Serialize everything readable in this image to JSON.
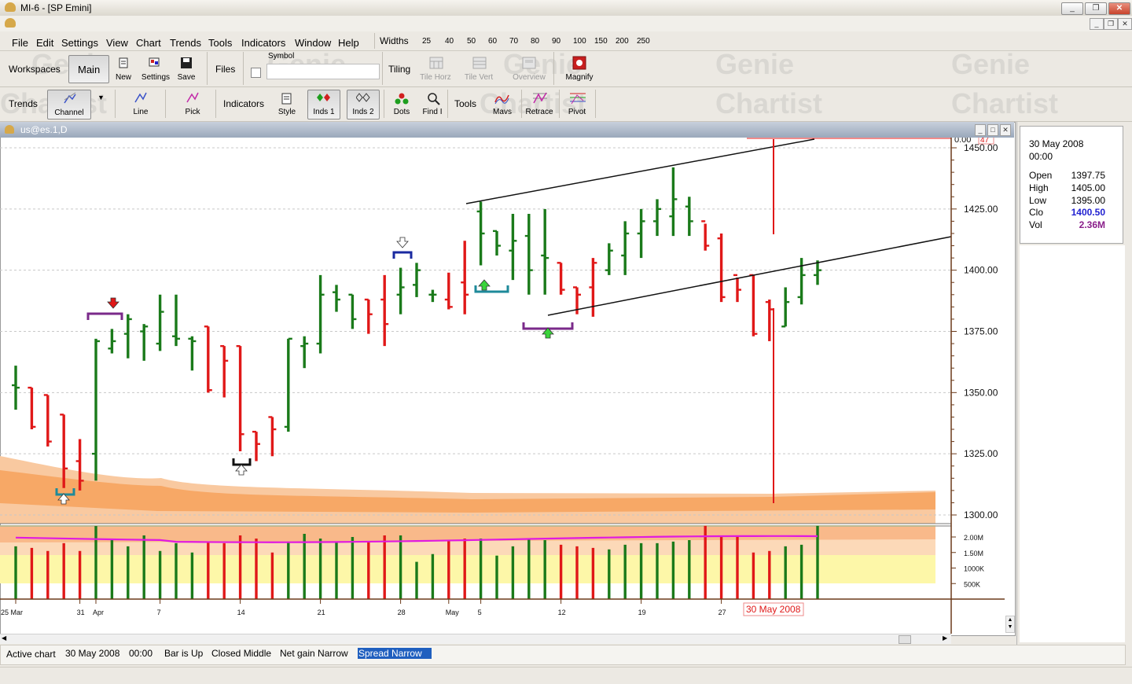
{
  "window": {
    "title": "MI-6 - [SP Emini]"
  },
  "menu": [
    "File",
    "Edit",
    "Settings",
    "View",
    "Chart",
    "Trends",
    "Tools",
    "Indicators",
    "Window",
    "Help"
  ],
  "widths": {
    "label": "Widths",
    "values": [
      "25",
      "40",
      "50",
      "60",
      "70",
      "80",
      "90",
      "100",
      "150",
      "200",
      "250"
    ]
  },
  "toolbar1": {
    "workspaces_label": "Workspaces",
    "main_button": "Main",
    "new_label": "New",
    "settings_label": "Settings",
    "save_label": "Save",
    "files_label": "Files",
    "symbol_label": "Symbol",
    "symbol_value": "",
    "tiling_label": "Tiling",
    "tile_horz": "Tile Horz",
    "tile_vert": "Tile Vert",
    "overview": "Overview",
    "magnify": "Magnify"
  },
  "toolbar2": {
    "trends_label": "Trends",
    "channel": "Channel",
    "line": "Line",
    "pick": "Pick",
    "indicators_label": "Indicators",
    "style": "Style",
    "inds1": "Inds 1",
    "inds2": "Inds 2",
    "dots": "Dots",
    "find": "Find I",
    "tools_label": "Tools",
    "mavs": "Mavs",
    "retrace": "Retrace",
    "pivot": "Pivot"
  },
  "chart_window": {
    "title": "us@es.1,D",
    "top_scale_value": "0.00",
    "top_scale_badge": "47"
  },
  "info_panel": {
    "date": "30 May 2008",
    "time": "00:00",
    "rows": [
      {
        "label": "Open",
        "value": "1397.75",
        "color": "#000000"
      },
      {
        "label": "High",
        "value": "1405.00",
        "color": "#000000"
      },
      {
        "label": "Low",
        "value": "1395.00",
        "color": "#000000"
      },
      {
        "label": "Clo",
        "value": "1400.50",
        "color": "#1f1fd0"
      },
      {
        "label": "Vol",
        "value": "2.36M",
        "color": "#8a1f8a"
      }
    ]
  },
  "chart_data": {
    "type": "bar",
    "instrument": "us@es.1,D",
    "price_axis": {
      "ticks": [
        "1450.00",
        "1425.00",
        "1400.00",
        "1375.00",
        "1350.00",
        "1325.00",
        "1300.00"
      ],
      "ylim": [
        1300,
        1450
      ]
    },
    "volume_axis": {
      "ticks": [
        "2.00M",
        "1.50M",
        "1000K",
        "500K"
      ]
    },
    "x_labels": [
      {
        "label": "25 Mar",
        "bar": 0
      },
      {
        "label": "31",
        "bar": 4
      },
      {
        "label": "Apr",
        "bar": 5
      },
      {
        "label": "7",
        "bar": 9
      },
      {
        "label": "14",
        "bar": 14
      },
      {
        "label": "21",
        "bar": 19
      },
      {
        "label": "28",
        "bar": 24
      },
      {
        "label": "May",
        "bar": 27
      },
      {
        "label": "5",
        "bar": 29
      },
      {
        "label": "12",
        "bar": 34
      },
      {
        "label": "19",
        "bar": 39
      },
      {
        "label": "27",
        "bar": 44
      }
    ],
    "cursor_date_label": "30 May 2008",
    "bars": [
      {
        "o": 1353,
        "h": 1361,
        "l": 1343,
        "c": 1352,
        "up": true,
        "v": 1.7
      },
      {
        "o": 1352,
        "h": 1352,
        "l": 1335,
        "c": 1336,
        "up": false,
        "v": 1.65
      },
      {
        "o": 1349,
        "h": 1349,
        "l": 1328,
        "c": 1330,
        "up": false,
        "v": 1.55
      },
      {
        "o": 1341,
        "h": 1341,
        "l": 1311,
        "c": 1319,
        "up": false,
        "v": 1.8
      },
      {
        "o": 1322,
        "h": 1331,
        "l": 1310,
        "c": 1314,
        "up": false,
        "v": 1.55
      },
      {
        "o": 1325,
        "h": 1372,
        "l": 1314,
        "c": 1371,
        "up": true,
        "v": 2.35
      },
      {
        "o": 1368,
        "h": 1376,
        "l": 1366,
        "c": 1371,
        "up": true,
        "v": 1.9
      },
      {
        "o": 1374,
        "h": 1382,
        "l": 1364,
        "c": 1380,
        "up": true,
        "v": 1.7
      },
      {
        "o": 1375,
        "h": 1378,
        "l": 1363,
        "c": 1377,
        "up": true,
        "v": 2.05
      },
      {
        "o": 1370,
        "h": 1390,
        "l": 1367,
        "c": 1383,
        "up": true,
        "v": 1.55
      },
      {
        "o": 1373,
        "h": 1390,
        "l": 1369,
        "c": 1372,
        "up": true,
        "v": 1.8
      },
      {
        "o": 1372,
        "h": 1373,
        "l": 1359,
        "c": 1371,
        "up": true,
        "v": 1.5
      },
      {
        "o": 1377,
        "h": 1377,
        "l": 1350,
        "c": 1351,
        "up": false,
        "v": 1.85
      },
      {
        "o": 1369,
        "h": 1369,
        "l": 1348,
        "c": 1363,
        "up": false,
        "v": 1.8
      },
      {
        "o": 1369,
        "h": 1369,
        "l": 1326,
        "c": 1333,
        "up": false,
        "v": 2.05
      },
      {
        "o": 1334,
        "h": 1334,
        "l": 1322,
        "c": 1329,
        "up": false,
        "v": 1.95
      },
      {
        "o": 1340,
        "h": 1340,
        "l": 1324,
        "c": 1335,
        "up": false,
        "v": 1.5
      },
      {
        "o": 1336,
        "h": 1372,
        "l": 1334,
        "c": 1372,
        "up": true,
        "v": 1.85
      },
      {
        "o": 1369,
        "h": 1373,
        "l": 1360,
        "c": 1370,
        "up": true,
        "v": 2.1
      },
      {
        "o": 1370,
        "h": 1398,
        "l": 1366,
        "c": 1390,
        "up": true,
        "v": 1.95
      },
      {
        "o": 1391,
        "h": 1394,
        "l": 1383,
        "c": 1388,
        "up": true,
        "v": 1.85
      },
      {
        "o": 1390,
        "h": 1390,
        "l": 1376,
        "c": 1380,
        "up": true,
        "v": 2.0
      },
      {
        "o": 1388,
        "h": 1388,
        "l": 1374,
        "c": 1382,
        "up": false,
        "v": 1.85
      },
      {
        "o": 1388,
        "h": 1398,
        "l": 1369,
        "c": 1378,
        "up": false,
        "v": 2.05
      },
      {
        "o": 1390,
        "h": 1401,
        "l": 1382,
        "c": 1393,
        "up": true,
        "v": 2.05
      },
      {
        "o": 1394,
        "h": 1403,
        "l": 1389,
        "c": 1400,
        "up": true,
        "v": 1.2
      },
      {
        "o": 1390,
        "h": 1392,
        "l": 1387,
        "c": 1390,
        "up": true,
        "v": 1.45
      },
      {
        "o": 1388,
        "h": 1399,
        "l": 1384,
        "c": 1385,
        "up": false,
        "v": 1.9
      },
      {
        "o": 1395,
        "h": 1412,
        "l": 1382,
        "c": 1390,
        "up": false,
        "v": 1.95
      },
      {
        "o": 1424,
        "h": 1428,
        "l": 1402,
        "c": 1415,
        "up": true,
        "v": 1.95
      },
      {
        "o": 1416,
        "h": 1416,
        "l": 1406,
        "c": 1410,
        "up": true,
        "v": 1.4
      },
      {
        "o": 1408,
        "h": 1423,
        "l": 1396,
        "c": 1412,
        "up": true,
        "v": 1.7
      },
      {
        "o": 1414,
        "h": 1423,
        "l": 1390,
        "c": 1400,
        "up": true,
        "v": 1.95
      },
      {
        "o": 1406,
        "h": 1425,
        "l": 1390,
        "c": 1405,
        "up": true,
        "v": 1.9
      },
      {
        "o": 1403,
        "h": 1403,
        "l": 1390,
        "c": 1392,
        "up": false,
        "v": 1.75
      },
      {
        "o": 1393,
        "h": 1393,
        "l": 1382,
        "c": 1390,
        "up": false,
        "v": 1.7
      },
      {
        "o": 1393,
        "h": 1405,
        "l": 1381,
        "c": 1403,
        "up": false,
        "v": 1.65
      },
      {
        "o": 1400,
        "h": 1411,
        "l": 1398,
        "c": 1408,
        "up": true,
        "v": 1.6
      },
      {
        "o": 1406,
        "h": 1420,
        "l": 1398,
        "c": 1415,
        "up": true,
        "v": 1.75
      },
      {
        "o": 1415,
        "h": 1425,
        "l": 1405,
        "c": 1420,
        "up": true,
        "v": 1.8
      },
      {
        "o": 1420,
        "h": 1429,
        "l": 1414,
        "c": 1425,
        "up": true,
        "v": 1.8
      },
      {
        "o": 1422,
        "h": 1442,
        "l": 1414,
        "c": 1429,
        "up": true,
        "v": 1.85
      },
      {
        "o": 1426,
        "h": 1430,
        "l": 1414,
        "c": 1420,
        "up": true,
        "v": 1.9
      },
      {
        "o": 1420,
        "h": 1419,
        "l": 1408,
        "c": 1410,
        "up": false,
        "v": 2.36
      },
      {
        "o": 1413,
        "h": 1415,
        "l": 1387,
        "c": 1389,
        "up": false,
        "v": 2.05
      },
      {
        "o": 1398,
        "h": 1397,
        "l": 1387,
        "c": 1392,
        "up": false,
        "v": 2.0
      },
      {
        "o": 1398,
        "h": 1398,
        "l": 1373,
        "c": 1374,
        "up": false,
        "v": 1.5
      },
      {
        "o": 1387,
        "h": 1388,
        "l": 1371,
        "c": 1384,
        "up": false,
        "v": 1.55
      },
      {
        "o": 1377,
        "h": 1393,
        "l": 1377,
        "c": 1387,
        "up": true,
        "v": 1.7
      },
      {
        "o": 1389,
        "h": 1405,
        "l": 1386,
        "c": 1398,
        "up": true,
        "v": 1.75
      },
      {
        "o": 1398,
        "h": 1404,
        "l": 1394,
        "c": 1400,
        "up": true,
        "v": 2.36
      }
    ]
  },
  "status": {
    "active_chart_label": "Active chart",
    "date": "30 May 2008",
    "time": "00:00",
    "bar": "Bar is Up",
    "closed": "Closed Middle",
    "net": "Net gain Narrow",
    "spread": "Spread Narrow"
  }
}
